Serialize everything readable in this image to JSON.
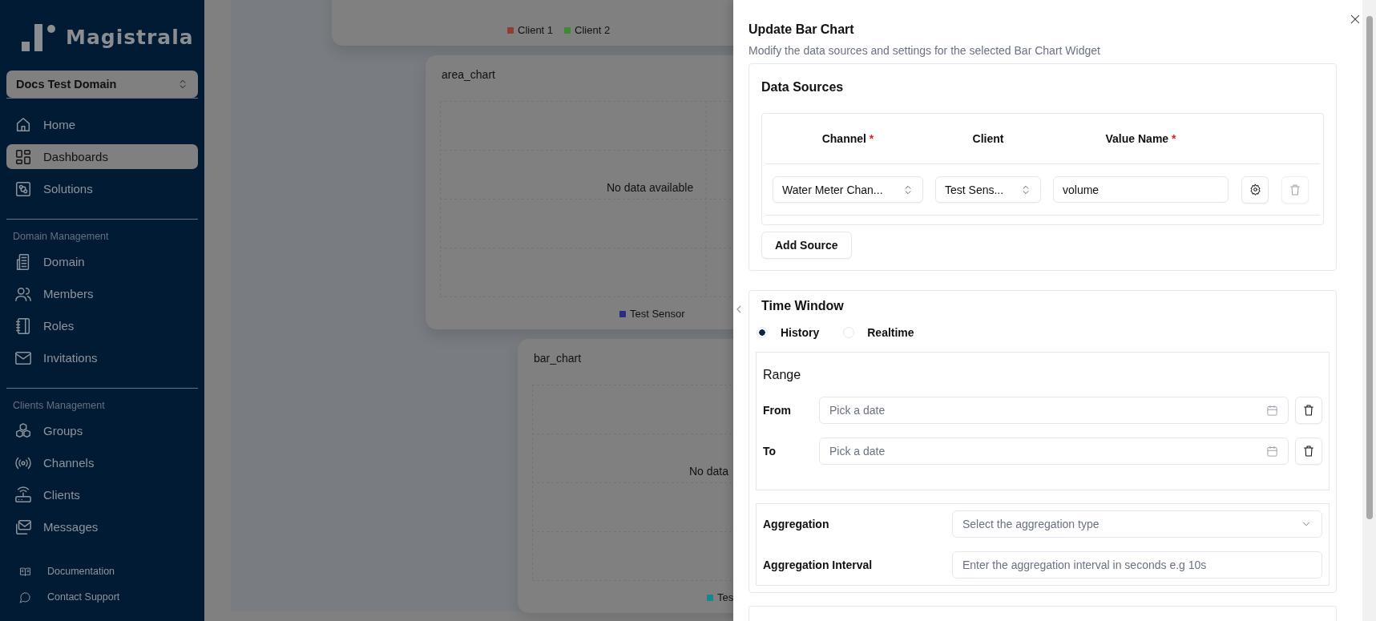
{
  "sidebar": {
    "brand": "Magistrala",
    "domain_selector": "Docs Test Domain",
    "sections": [
      {
        "items": [
          {
            "label": "Home",
            "selected": false
          },
          {
            "label": "Dashboards",
            "selected": true
          },
          {
            "label": "Solutions",
            "selected": false
          }
        ]
      },
      {
        "heading": "Domain Management",
        "items": [
          {
            "label": "Domain",
            "selected": false
          },
          {
            "label": "Members",
            "selected": false
          },
          {
            "label": "Roles",
            "selected": false
          },
          {
            "label": "Invitations",
            "selected": false
          }
        ]
      },
      {
        "heading": "Clients Management",
        "items": [
          {
            "label": "Groups",
            "selected": false
          },
          {
            "label": "Channels",
            "selected": false
          },
          {
            "label": "Clients",
            "selected": false
          },
          {
            "label": "Messages",
            "selected": false
          }
        ]
      }
    ],
    "footer_links": [
      "Documentation",
      "Contact Support"
    ]
  },
  "widgets": [
    {
      "legend": [
        {
          "label": "Client 1",
          "color": "#8f3f2d"
        },
        {
          "label": "Client 2",
          "color": "#3e8a33"
        }
      ]
    },
    {
      "title": "area_chart",
      "message": "No data available",
      "legend": [
        {
          "label": "Test Sensor",
          "color": "#2c2a88"
        }
      ]
    },
    {
      "title": "bar_chart",
      "message": "No data",
      "legend": [
        {
          "label": "Tes",
          "color": "#16878f"
        }
      ]
    }
  ],
  "dialog": {
    "title": "Update Bar Chart",
    "description": "Modify the data sources and settings for the selected Bar Chart Widget",
    "data_sources": {
      "heading": "Data Sources",
      "columns": [
        {
          "label": "Channel",
          "required_marker": "*"
        },
        {
          "label": "Client"
        },
        {
          "label": "Value Name",
          "required_marker": "*"
        }
      ],
      "rows": [
        {
          "channel": "Water Meter Chan...",
          "client": "Test Sens...",
          "value_name": "volume"
        }
      ],
      "add_button": "Add Source"
    },
    "time_window": {
      "heading": "Time Window",
      "modes": [
        {
          "label": "History",
          "selected": true
        },
        {
          "label": "Realtime",
          "selected": false
        }
      ],
      "range": {
        "heading": "Range",
        "fields": [
          {
            "label": "From",
            "placeholder": "Pick a date"
          },
          {
            "label": "To",
            "placeholder": "Pick a date"
          }
        ]
      },
      "aggregation": {
        "label": "Aggregation",
        "placeholder": "Select the aggregation type"
      },
      "interval": {
        "label": "Aggregation Interval",
        "placeholder": "Enter the aggregation interval in seconds e.g 10s"
      }
    }
  }
}
